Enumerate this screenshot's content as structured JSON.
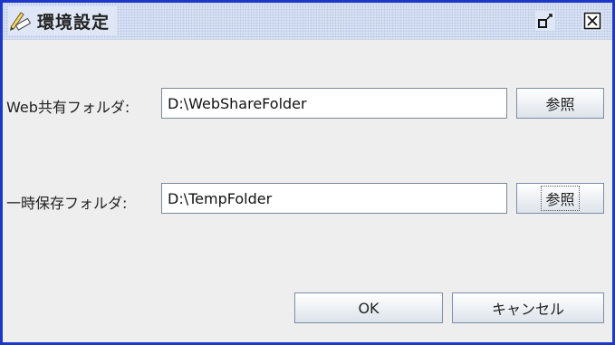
{
  "window": {
    "title": "環境設定",
    "icons": {
      "app": "pencil-ruler-icon",
      "restore": "restore-icon",
      "close": "close-icon"
    }
  },
  "web_share": {
    "label": "Web共有フォルダ:",
    "value": "D:\\WebShareFolder",
    "browse_label": "参照"
  },
  "temp": {
    "label": "一時保存フォルダ:",
    "value": "D:\\TempFolder",
    "browse_label": "参照"
  },
  "buttons": {
    "ok": "OK",
    "cancel": "キャンセル"
  },
  "colors": {
    "frame": "#1d37c9",
    "background": "#eeeeee"
  }
}
